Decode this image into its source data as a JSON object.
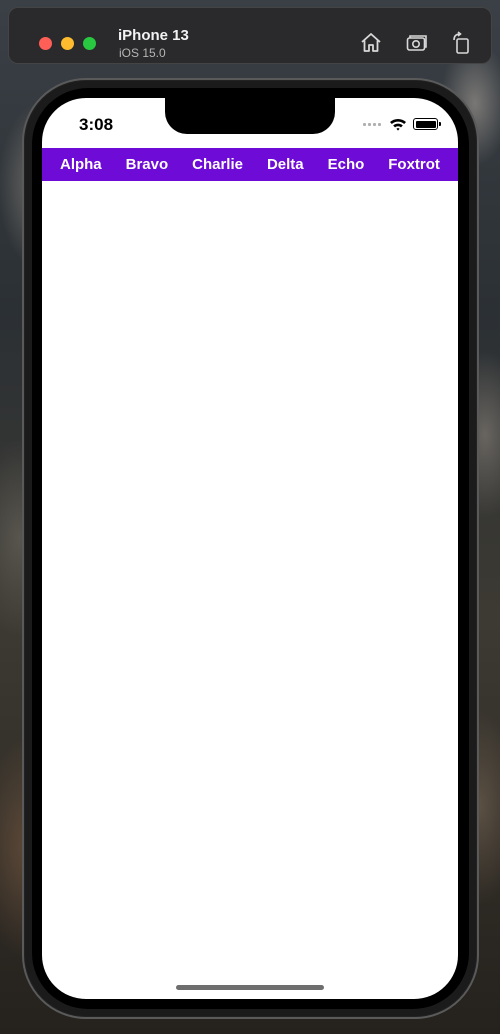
{
  "simulator": {
    "device_name": "iPhone 13",
    "os_version": "iOS 15.0",
    "buttons": [
      "home-icon",
      "screenshot-icon",
      "rotate-icon"
    ]
  },
  "status_bar": {
    "time": "3:08"
  },
  "tabs": [
    {
      "label": "Alpha"
    },
    {
      "label": "Bravo"
    },
    {
      "label": "Charlie"
    },
    {
      "label": "Delta"
    },
    {
      "label": "Echo"
    },
    {
      "label": "Foxtrot"
    }
  ],
  "colors": {
    "tab_bar": "#6f0bd6",
    "tab_text": "#ffffff"
  }
}
